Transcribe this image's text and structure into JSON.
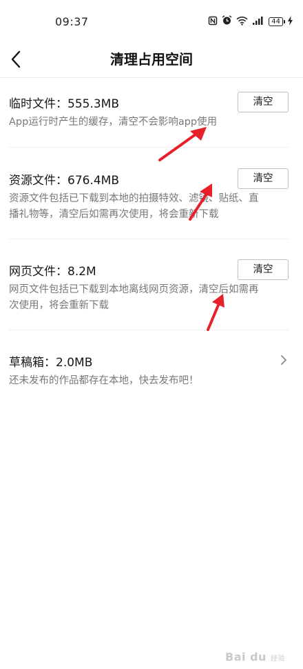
{
  "status_bar": {
    "time": "09:37",
    "icons": [
      "nfc-icon",
      "alarm-icon",
      "wifi-icon",
      "signal-icon",
      "battery-icon",
      "charging-icon"
    ],
    "battery_level": "44"
  },
  "nav": {
    "back_icon": "chevron-left-icon",
    "title": "清理占用空间"
  },
  "sections": [
    {
      "title": "临时文件：555.3MB",
      "description": [
        "App运行时产生的缓存，清空不会影响app使用"
      ],
      "button_label": "清空"
    },
    {
      "title": "资源文件：676.4MB",
      "description": [
        "资源文件包括已下载到本地的拍摄特效、滤镜、贴纸、直",
        "播礼物等，清空后如需再次使用，将会重新下载"
      ],
      "button_label": "清空"
    },
    {
      "title": "网页文件：8.2M",
      "description": [
        "网页文件包括已下载到本地离线网页资源，清空后如需再",
        "次使用，将会重新下载"
      ],
      "button_label": "清空"
    },
    {
      "title": "草稿箱：2.0MB",
      "description": [
        "还未发布的作品都存在本地，快去发布吧！"
      ],
      "action_icon": "chevron-right-icon"
    }
  ],
  "annotation_color": "#e8202a",
  "watermark": {
    "brand": "Bai du",
    "suffix": "经验"
  }
}
